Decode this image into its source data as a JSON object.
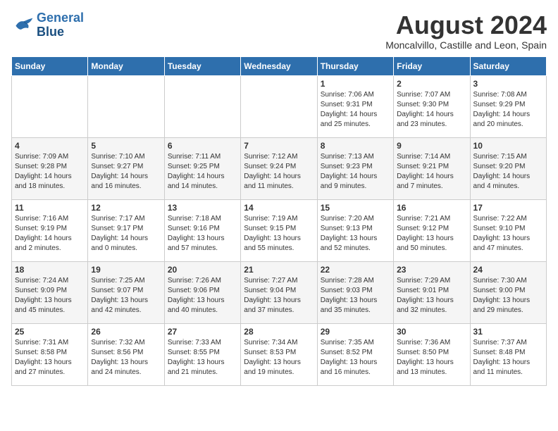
{
  "header": {
    "logo_line1": "General",
    "logo_line2": "Blue",
    "month_year": "August 2024",
    "location": "Moncalvillo, Castille and Leon, Spain"
  },
  "days_of_week": [
    "Sunday",
    "Monday",
    "Tuesday",
    "Wednesday",
    "Thursday",
    "Friday",
    "Saturday"
  ],
  "weeks": [
    [
      {
        "day": "",
        "info": ""
      },
      {
        "day": "",
        "info": ""
      },
      {
        "day": "",
        "info": ""
      },
      {
        "day": "",
        "info": ""
      },
      {
        "day": "1",
        "info": "Sunrise: 7:06 AM\nSunset: 9:31 PM\nDaylight: 14 hours and 25 minutes."
      },
      {
        "day": "2",
        "info": "Sunrise: 7:07 AM\nSunset: 9:30 PM\nDaylight: 14 hours and 23 minutes."
      },
      {
        "day": "3",
        "info": "Sunrise: 7:08 AM\nSunset: 9:29 PM\nDaylight: 14 hours and 20 minutes."
      }
    ],
    [
      {
        "day": "4",
        "info": "Sunrise: 7:09 AM\nSunset: 9:28 PM\nDaylight: 14 hours and 18 minutes."
      },
      {
        "day": "5",
        "info": "Sunrise: 7:10 AM\nSunset: 9:27 PM\nDaylight: 14 hours and 16 minutes."
      },
      {
        "day": "6",
        "info": "Sunrise: 7:11 AM\nSunset: 9:25 PM\nDaylight: 14 hours and 14 minutes."
      },
      {
        "day": "7",
        "info": "Sunrise: 7:12 AM\nSunset: 9:24 PM\nDaylight: 14 hours and 11 minutes."
      },
      {
        "day": "8",
        "info": "Sunrise: 7:13 AM\nSunset: 9:23 PM\nDaylight: 14 hours and 9 minutes."
      },
      {
        "day": "9",
        "info": "Sunrise: 7:14 AM\nSunset: 9:21 PM\nDaylight: 14 hours and 7 minutes."
      },
      {
        "day": "10",
        "info": "Sunrise: 7:15 AM\nSunset: 9:20 PM\nDaylight: 14 hours and 4 minutes."
      }
    ],
    [
      {
        "day": "11",
        "info": "Sunrise: 7:16 AM\nSunset: 9:19 PM\nDaylight: 14 hours and 2 minutes."
      },
      {
        "day": "12",
        "info": "Sunrise: 7:17 AM\nSunset: 9:17 PM\nDaylight: 14 hours and 0 minutes."
      },
      {
        "day": "13",
        "info": "Sunrise: 7:18 AM\nSunset: 9:16 PM\nDaylight: 13 hours and 57 minutes."
      },
      {
        "day": "14",
        "info": "Sunrise: 7:19 AM\nSunset: 9:15 PM\nDaylight: 13 hours and 55 minutes."
      },
      {
        "day": "15",
        "info": "Sunrise: 7:20 AM\nSunset: 9:13 PM\nDaylight: 13 hours and 52 minutes."
      },
      {
        "day": "16",
        "info": "Sunrise: 7:21 AM\nSunset: 9:12 PM\nDaylight: 13 hours and 50 minutes."
      },
      {
        "day": "17",
        "info": "Sunrise: 7:22 AM\nSunset: 9:10 PM\nDaylight: 13 hours and 47 minutes."
      }
    ],
    [
      {
        "day": "18",
        "info": "Sunrise: 7:24 AM\nSunset: 9:09 PM\nDaylight: 13 hours and 45 minutes."
      },
      {
        "day": "19",
        "info": "Sunrise: 7:25 AM\nSunset: 9:07 PM\nDaylight: 13 hours and 42 minutes."
      },
      {
        "day": "20",
        "info": "Sunrise: 7:26 AM\nSunset: 9:06 PM\nDaylight: 13 hours and 40 minutes."
      },
      {
        "day": "21",
        "info": "Sunrise: 7:27 AM\nSunset: 9:04 PM\nDaylight: 13 hours and 37 minutes."
      },
      {
        "day": "22",
        "info": "Sunrise: 7:28 AM\nSunset: 9:03 PM\nDaylight: 13 hours and 35 minutes."
      },
      {
        "day": "23",
        "info": "Sunrise: 7:29 AM\nSunset: 9:01 PM\nDaylight: 13 hours and 32 minutes."
      },
      {
        "day": "24",
        "info": "Sunrise: 7:30 AM\nSunset: 9:00 PM\nDaylight: 13 hours and 29 minutes."
      }
    ],
    [
      {
        "day": "25",
        "info": "Sunrise: 7:31 AM\nSunset: 8:58 PM\nDaylight: 13 hours and 27 minutes."
      },
      {
        "day": "26",
        "info": "Sunrise: 7:32 AM\nSunset: 8:56 PM\nDaylight: 13 hours and 24 minutes."
      },
      {
        "day": "27",
        "info": "Sunrise: 7:33 AM\nSunset: 8:55 PM\nDaylight: 13 hours and 21 minutes."
      },
      {
        "day": "28",
        "info": "Sunrise: 7:34 AM\nSunset: 8:53 PM\nDaylight: 13 hours and 19 minutes."
      },
      {
        "day": "29",
        "info": "Sunrise: 7:35 AM\nSunset: 8:52 PM\nDaylight: 13 hours and 16 minutes."
      },
      {
        "day": "30",
        "info": "Sunrise: 7:36 AM\nSunset: 8:50 PM\nDaylight: 13 hours and 13 minutes."
      },
      {
        "day": "31",
        "info": "Sunrise: 7:37 AM\nSunset: 8:48 PM\nDaylight: 13 hours and 11 minutes."
      }
    ]
  ]
}
